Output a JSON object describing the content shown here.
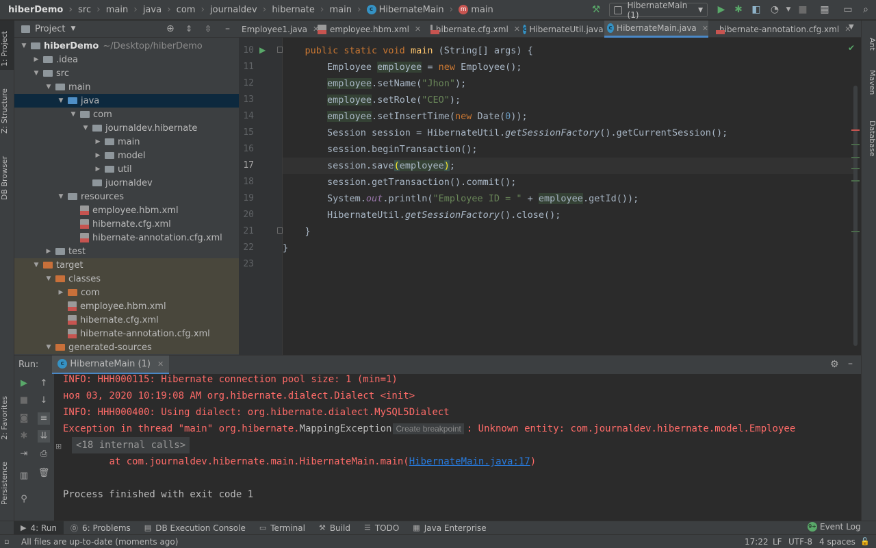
{
  "navbar": {
    "crumbs": [
      "hiberDemo",
      "src",
      "main",
      "java",
      "com",
      "journaldev",
      "hibernate",
      "main",
      "HibernateMain",
      "main"
    ],
    "run_config": "HibernateMain (1)"
  },
  "left_strip": {
    "project": "1: Project",
    "structure": "Z: Structure",
    "db_browser": "DB Browser",
    "favorites": "2: Favorites",
    "persistence": "Persistence"
  },
  "right_strip": {
    "ant": "Ant",
    "maven": "Maven",
    "database": "Database"
  },
  "project_panel": {
    "title": "Project",
    "tree": [
      {
        "label": "hiberDemo",
        "extra": "~/Desktop/hiberDemo",
        "depth": 0,
        "chev": "down",
        "icon": "gray",
        "bold": true
      },
      {
        "label": ".idea",
        "depth": 1,
        "chev": "right",
        "icon": "gray"
      },
      {
        "label": "src",
        "depth": 1,
        "chev": "down",
        "icon": "gray"
      },
      {
        "label": "main",
        "depth": 2,
        "chev": "down",
        "icon": "gray"
      },
      {
        "label": "java",
        "depth": 3,
        "chev": "down",
        "icon": "blue",
        "selected": true
      },
      {
        "label": "com",
        "depth": 4,
        "chev": "down",
        "icon": "gray"
      },
      {
        "label": "journaldev.hibernate",
        "depth": 5,
        "chev": "down",
        "icon": "gray"
      },
      {
        "label": "main",
        "depth": 6,
        "chev": "right",
        "icon": "gray"
      },
      {
        "label": "model",
        "depth": 6,
        "chev": "right",
        "icon": "gray"
      },
      {
        "label": "util",
        "depth": 6,
        "chev": "right",
        "icon": "gray"
      },
      {
        "label": "juornaldev",
        "depth": 5,
        "chev": "none",
        "icon": "gray"
      },
      {
        "label": "resources",
        "depth": 3,
        "chev": "down",
        "icon": "res"
      },
      {
        "label": "employee.hbm.xml",
        "depth": 4,
        "chev": "none",
        "icon": "xml"
      },
      {
        "label": "hibernate.cfg.xml",
        "depth": 4,
        "chev": "none",
        "icon": "xml"
      },
      {
        "label": "hibernate-annotation.cfg.xml",
        "depth": 4,
        "chev": "none",
        "icon": "xml"
      },
      {
        "label": "test",
        "depth": 2,
        "chev": "right",
        "icon": "gray"
      },
      {
        "label": "target",
        "depth": 1,
        "chev": "down",
        "icon": "orange",
        "excluded": true
      },
      {
        "label": "classes",
        "depth": 2,
        "chev": "down",
        "icon": "orange",
        "excluded": true
      },
      {
        "label": "com",
        "depth": 3,
        "chev": "right",
        "icon": "orange",
        "excluded": true
      },
      {
        "label": "employee.hbm.xml",
        "depth": 3,
        "chev": "none",
        "icon": "xml",
        "excluded": true
      },
      {
        "label": "hibernate.cfg.xml",
        "depth": 3,
        "chev": "none",
        "icon": "xml",
        "excluded": true
      },
      {
        "label": "hibernate-annotation.cfg.xml",
        "depth": 3,
        "chev": "none",
        "icon": "xml",
        "excluded": true
      },
      {
        "label": "generated-sources",
        "depth": 2,
        "chev": "down",
        "icon": "orange",
        "excluded": true
      }
    ]
  },
  "tabs": [
    {
      "label": "Employee1.java",
      "type": "java-plain"
    },
    {
      "label": "employee.hbm.xml",
      "type": "xml"
    },
    {
      "label": "hibernate.cfg.xml",
      "type": "xml"
    },
    {
      "label": "HibernateUtil.java",
      "type": "class"
    },
    {
      "label": "HibernateMain.java",
      "type": "class",
      "active": true
    },
    {
      "label": "hibernate-annotation.cfg.xml",
      "type": "xml"
    }
  ],
  "editor": {
    "line_numbers": [
      "10",
      "11",
      "12",
      "13",
      "14",
      "15",
      "16",
      "17",
      "18",
      "19",
      "20",
      "21",
      "22",
      "23"
    ],
    "current_line": "17"
  },
  "run_panel": {
    "label": "Run:",
    "tab": "HibernateMain (1)",
    "console": {
      "l1": "INFO: HHH000115: Hibernate connection pool size: 1 (min=1)",
      "l2": "ноя 03, 2020 10:19:08 AM org.hibernate.dialect.Dialect <init>",
      "l3": "INFO: HHH000400: Using dialect: org.hibernate.dialect.MySQL5Dialect",
      "l4a": "Exception in thread \"main\" org.hibernate.",
      "l4b": "MappingException",
      "l4hint": "Create breakpoint",
      "l4c": ": Unknown entity: com.journaldev.hibernate.model.Employee",
      "l5": "<18 internal calls>",
      "l6a": "\tat com.journaldev.hibernate.main.HibernateMain.main(",
      "l6link": "HibernateMain.java:17",
      "l6b": ")",
      "l7": "Process finished with exit code 1"
    }
  },
  "tool_windows": [
    {
      "label": "4: Run",
      "active": true,
      "glyph": "▶"
    },
    {
      "label": "6: Problems",
      "glyph": "⓪"
    },
    {
      "label": "DB Execution Console",
      "glyph": "▤"
    },
    {
      "label": "Terminal",
      "glyph": "▭"
    },
    {
      "label": "Build",
      "glyph": "⚒"
    },
    {
      "label": "TODO",
      "glyph": "☰"
    },
    {
      "label": "Java Enterprise",
      "glyph": "▦"
    }
  ],
  "event_log": "Event Log",
  "status": {
    "message": "All files are up-to-date (moments ago)",
    "position": "17:22",
    "line_sep": "LF",
    "encoding": "UTF-8",
    "indent": "4 spaces"
  }
}
